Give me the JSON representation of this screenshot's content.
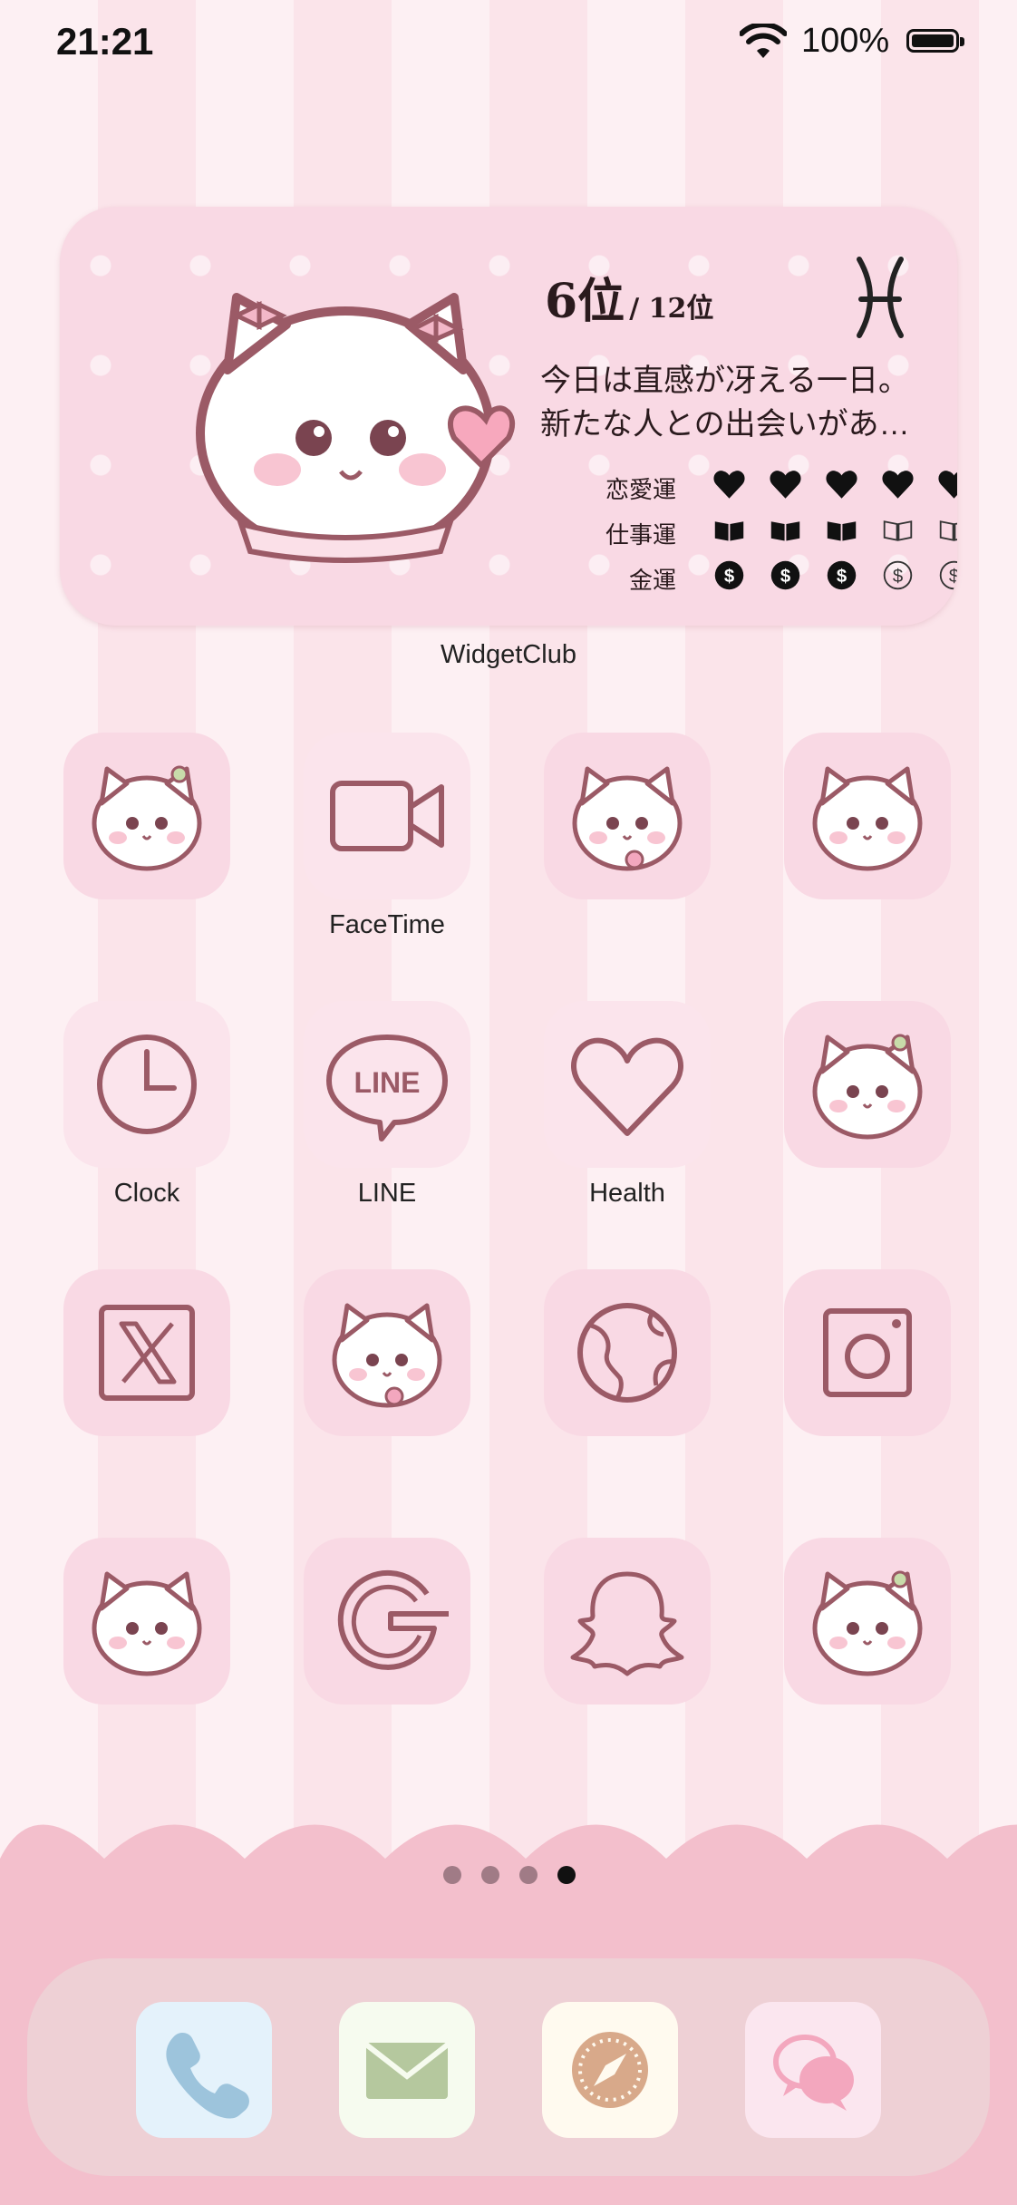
{
  "status_bar": {
    "time": "21:21",
    "battery": "100%"
  },
  "widget": {
    "rank": "6位",
    "rank_total": "/ 12位",
    "zodiac_icon": "pisces-icon",
    "fortune_line1": "今日は直感が冴える一日。",
    "fortune_line2": "新たな人との出会いがあ…",
    "categories": [
      {
        "label": "恋愛運",
        "icon": "heart-icon",
        "filled": 5,
        "total": 5
      },
      {
        "label": "仕事運",
        "icon": "book-icon",
        "filled": 3,
        "total": 5
      },
      {
        "label": "金運",
        "icon": "coin-icon",
        "filled": 3,
        "total": 5
      }
    ],
    "app_label": "WidgetClub"
  },
  "apps": [
    {
      "label": "",
      "icon": "bunny-mascot-icon"
    },
    {
      "label": "FaceTime",
      "icon": "video-camera-icon"
    },
    {
      "label": "",
      "icon": "bunny-mascot-icon"
    },
    {
      "label": "",
      "icon": "bunny-mascot-icon"
    },
    {
      "label": "Clock",
      "icon": "clock-icon"
    },
    {
      "label": "LINE",
      "icon": "line-bubble-icon",
      "icon_text": "LINE"
    },
    {
      "label": "Health",
      "icon": "heart-outline-icon"
    },
    {
      "label": "",
      "icon": "bunny-mascot-icon"
    },
    {
      "label": "",
      "icon": "x-logo-icon"
    },
    {
      "label": "",
      "icon": "bunny-mascot-icon"
    },
    {
      "label": "",
      "icon": "globe-icon"
    },
    {
      "label": "",
      "icon": "instagram-camera-icon"
    },
    {
      "label": "",
      "icon": "bunny-mascot-icon"
    },
    {
      "label": "",
      "icon": "google-g-icon"
    },
    {
      "label": "",
      "icon": "snapchat-ghost-icon"
    },
    {
      "label": "",
      "icon": "bunny-mascot-icon"
    }
  ],
  "page_indicator": {
    "pages": 4,
    "current": 4
  },
  "dock": [
    {
      "icon": "phone-icon",
      "color": "#e4f2fb"
    },
    {
      "icon": "mail-icon",
      "color": "#f6fbef"
    },
    {
      "icon": "compass-icon",
      "color": "#fffaef"
    },
    {
      "icon": "chat-bubbles-icon",
      "color": "#fbe6ef"
    }
  ],
  "colors": {
    "icon_stroke": "#9b5a66",
    "accent_pink": "#f0b8c8",
    "widget_bg": "#f9d9e4"
  }
}
